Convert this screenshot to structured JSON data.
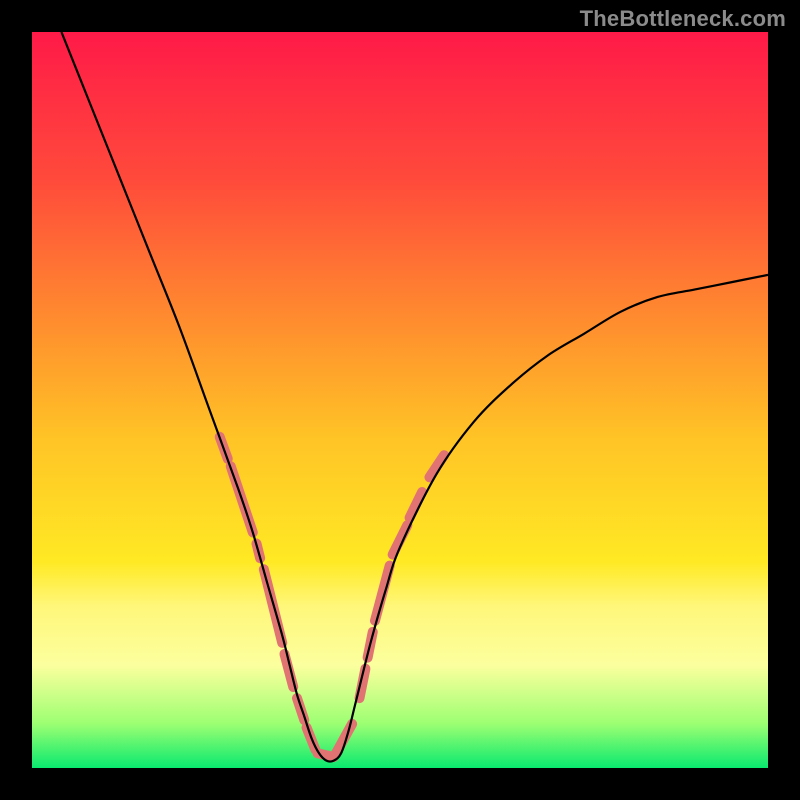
{
  "watermark": "TheBottleneck.com",
  "chart_data": {
    "type": "line",
    "title": "",
    "xlabel": "",
    "ylabel": "",
    "xlim": [
      0,
      100
    ],
    "ylim": [
      0,
      100
    ],
    "background_gradient_stops": [
      {
        "offset": 0,
        "color": "#ff1a48"
      },
      {
        "offset": 0.2,
        "color": "#ff4a3b"
      },
      {
        "offset": 0.4,
        "color": "#ff8f2e"
      },
      {
        "offset": 0.55,
        "color": "#ffc326"
      },
      {
        "offset": 0.72,
        "color": "#ffe924"
      },
      {
        "offset": 0.78,
        "color": "#fff77a"
      },
      {
        "offset": 0.86,
        "color": "#fcff9e"
      },
      {
        "offset": 0.94,
        "color": "#9cff72"
      },
      {
        "offset": 1.0,
        "color": "#09e96f"
      }
    ],
    "series": [
      {
        "name": "bottleneck-curve",
        "color": "#000000",
        "width": 2.2,
        "x": [
          4,
          8,
          12,
          16,
          20,
          24,
          28,
          30,
          32,
          34,
          35,
          36,
          37,
          38,
          39,
          40,
          41,
          42,
          43,
          44,
          46,
          48,
          50,
          55,
          60,
          65,
          70,
          75,
          80,
          85,
          90,
          95,
          100
        ],
        "y": [
          100,
          90,
          80,
          70,
          60,
          49,
          38,
          32,
          25,
          18,
          14,
          10,
          7,
          4,
          2,
          1,
          1,
          2,
          5,
          9,
          17,
          24,
          30,
          40,
          47,
          52,
          56,
          59,
          62,
          64,
          65,
          66,
          67
        ]
      }
    ],
    "highlight_segments": {
      "color": "#e17472",
      "width": 10,
      "segments": [
        [
          [
            25.5,
            45
          ],
          [
            26.6,
            42
          ]
        ],
        [
          [
            27.0,
            41
          ],
          [
            30.0,
            32
          ]
        ],
        [
          [
            30.5,
            30.5
          ],
          [
            31.0,
            28.5
          ]
        ],
        [
          [
            31.5,
            27
          ],
          [
            34.0,
            17
          ]
        ],
        [
          [
            34.3,
            15.5
          ],
          [
            35.5,
            11
          ]
        ],
        [
          [
            36.0,
            9.5
          ],
          [
            37.0,
            6.5
          ]
        ],
        [
          [
            37.3,
            5.5
          ],
          [
            38.5,
            2.5
          ]
        ],
        [
          [
            38.8,
            2
          ],
          [
            41.0,
            1.5
          ]
        ],
        [
          [
            41.3,
            2
          ],
          [
            43.5,
            6
          ]
        ],
        [
          [
            44.5,
            9.5
          ],
          [
            45.3,
            13.5
          ]
        ],
        [
          [
            45.6,
            15
          ],
          [
            46.3,
            18.5
          ]
        ],
        [
          [
            46.6,
            20
          ],
          [
            48.6,
            27.5
          ]
        ],
        [
          [
            49.0,
            29
          ],
          [
            51.0,
            33
          ]
        ],
        [
          [
            51.3,
            34
          ],
          [
            53.0,
            37.5
          ]
        ],
        [
          [
            54.0,
            39.5
          ],
          [
            56.0,
            42.5
          ]
        ]
      ]
    }
  }
}
